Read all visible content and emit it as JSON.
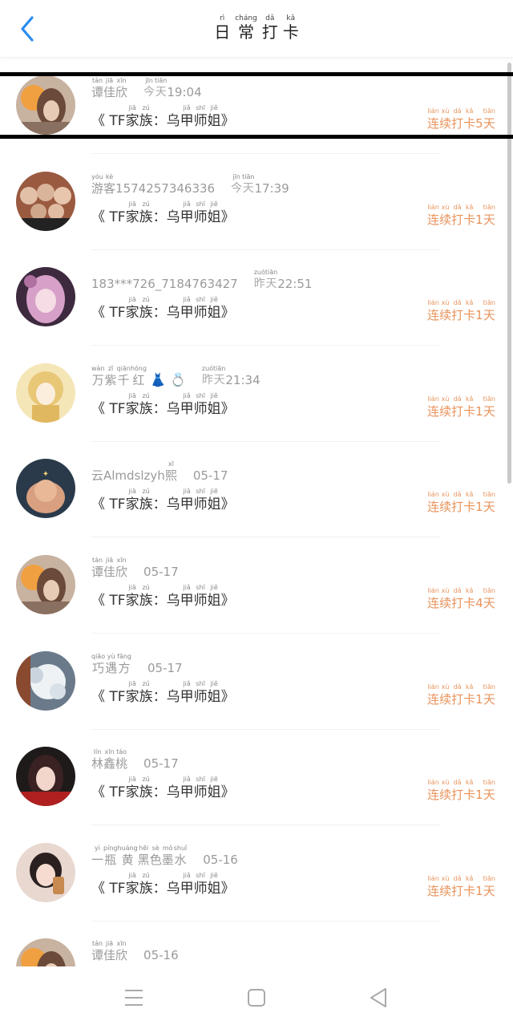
{
  "header": {
    "title": [
      {
        "hz": "日",
        "py": "rì"
      },
      {
        "hz": "常",
        "py": "cháng"
      },
      {
        "hz": "打",
        "py": "dǎ"
      },
      {
        "hz": "卡",
        "py": "kǎ"
      }
    ]
  },
  "topic": [
    {
      "t": "《 TF"
    },
    {
      "hz": "家",
      "py": "jiā"
    },
    {
      "hz": "族",
      "py": "zú"
    },
    {
      "t": "："
    },
    {
      "t": "乌"
    },
    {
      "hz": "甲",
      "py": "jiǎ"
    },
    {
      "hz": "师",
      "py": "shī"
    },
    {
      "hz": "姐",
      "py": "jiě"
    },
    {
      "t": " 》"
    }
  ],
  "streak_prefix": [
    {
      "hz": "连",
      "py": "lián"
    },
    {
      "hz": "续",
      "py": "xù"
    },
    {
      "hz": "打",
      "py": "dǎ"
    },
    {
      "hz": "卡",
      "py": "kǎ"
    }
  ],
  "streak_suffix": {
    "hz": "天",
    "py": "tiān"
  },
  "rows": [
    {
      "name": [
        {
          "hz": "谭",
          "py": "tán"
        },
        {
          "hz": "佳",
          "py": "jiā"
        },
        {
          "hz": "欣",
          "py": "xīn"
        }
      ],
      "time": [
        {
          "hz": "今",
          "py": "jīn"
        },
        {
          "hz": "天",
          "py": "tiān"
        },
        {
          "t": " 19:04"
        }
      ],
      "days": "5",
      "avatar": "a1"
    },
    {
      "name": [
        {
          "hz": "游",
          "py": "yóu"
        },
        {
          "hz": "客",
          "py": "kè"
        },
        {
          "t": "1574257346336"
        }
      ],
      "time": [
        {
          "hz": "今",
          "py": "jīn"
        },
        {
          "hz": "天",
          "py": "tiān"
        },
        {
          "t": " 17:39"
        }
      ],
      "days": "1",
      "avatar": "a2"
    },
    {
      "name": [
        {
          "t": "183***726_7184763427"
        }
      ],
      "time": [
        {
          "hz": "昨",
          "py": "zuó"
        },
        {
          "hz": "天",
          "py": "tiān"
        },
        {
          "t": " 22:51"
        }
      ],
      "days": "1",
      "avatar": "a3"
    },
    {
      "name": [
        {
          "hz": "万",
          "py": "wàn"
        },
        {
          "hz": "紫",
          "py": "zǐ"
        },
        {
          "hz": "千",
          "py": "qiān"
        },
        {
          "hz": "红",
          "py": "hóng"
        }
      ],
      "emoji": "👗 💍",
      "time": [
        {
          "hz": "昨",
          "py": "zuó"
        },
        {
          "hz": "天",
          "py": "tiān"
        },
        {
          "t": " 21:34"
        }
      ],
      "days": "1",
      "avatar": "a4"
    },
    {
      "name": [
        {
          "t": "云Almdslzyh"
        },
        {
          "hz": "熙",
          "py": "xī"
        }
      ],
      "time": [
        {
          "t": "05-17"
        }
      ],
      "days": "1",
      "avatar": "a5"
    },
    {
      "name": [
        {
          "hz": "谭",
          "py": "tán"
        },
        {
          "hz": "佳",
          "py": "jiā"
        },
        {
          "hz": "欣",
          "py": "xīn"
        }
      ],
      "time": [
        {
          "t": "05-17"
        }
      ],
      "days": "4",
      "avatar": "a1"
    },
    {
      "name": [
        {
          "hz": "巧",
          "py": "qiǎo"
        },
        {
          "hz": "遇",
          "py": "yù"
        },
        {
          "hz": "方",
          "py": "fāng"
        }
      ],
      "time": [
        {
          "t": "05-17"
        }
      ],
      "days": "1",
      "avatar": "a7"
    },
    {
      "name": [
        {
          "hz": "林",
          "py": "lín"
        },
        {
          "hz": "鑫",
          "py": "xīn"
        },
        {
          "hz": "桃",
          "py": "táo"
        }
      ],
      "time": [
        {
          "t": "05-17"
        }
      ],
      "days": "1",
      "avatar": "a8"
    },
    {
      "name": [
        {
          "hz": "一",
          "py": "yì"
        },
        {
          "hz": "瓶",
          "py": "píng"
        },
        {
          "hz": "黄",
          "py": "huáng"
        },
        {
          "hz": "黑",
          "py": "hēi"
        },
        {
          "hz": "色",
          "py": "sè"
        },
        {
          "hz": "墨",
          "py": "mò"
        },
        {
          "hz": "水",
          "py": "shuǐ"
        }
      ],
      "time": [
        {
          "t": "05-16"
        }
      ],
      "days": "1",
      "avatar": "a9"
    },
    {
      "name": [
        {
          "hz": "谭",
          "py": "tán"
        },
        {
          "hz": "佳",
          "py": "jiā"
        },
        {
          "hz": "欣",
          "py": "xīn"
        }
      ],
      "time": [
        {
          "t": "05-16"
        }
      ],
      "days": "",
      "avatar": "a1"
    }
  ],
  "colors": {
    "accent": "#2a8cf0",
    "streak": "#e8935c"
  },
  "icons": {
    "back": "chevron-left-icon",
    "menu": "menu-icon",
    "home": "square-icon",
    "back_nav": "triangle-back-icon"
  }
}
